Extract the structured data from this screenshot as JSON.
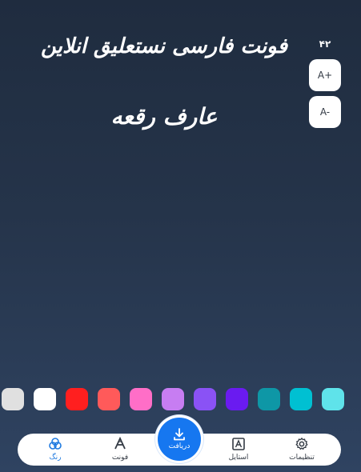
{
  "headline": {
    "line1": "فونت فارسی نستعلیق انلاین",
    "line2": "عارف رقعه"
  },
  "font_size": {
    "value": "۴۲",
    "increase_label": "A+",
    "decrease_label": "A-"
  },
  "palette": {
    "selected": null,
    "colors": [
      "#e0e0e0",
      "#ffffff",
      "#ff1f1f",
      "#ff5a5a",
      "#ff6ec7",
      "#c77df2",
      "#8a52f5",
      "#6a1bf0",
      "#0e97a6",
      "#00c0d2",
      "#5fe3ea"
    ]
  },
  "bottom_nav": {
    "items": [
      {
        "id": "color",
        "label": "رنگ",
        "icon": "palette-circles-icon",
        "active": true
      },
      {
        "id": "font",
        "label": "فونت",
        "icon": "font-a-icon",
        "active": false
      },
      {
        "id": "style",
        "label": "استایل",
        "icon": "style-box-icon",
        "active": false
      },
      {
        "id": "settings",
        "label": "تنظیمات",
        "icon": "gear-icon",
        "active": false
      }
    ],
    "download": {
      "label": "دریافت",
      "icon": "download-icon"
    }
  },
  "colors": {
    "accent": "#1677f0",
    "nav_background": "#ffffff",
    "text_on_dark": "#ffffff"
  }
}
